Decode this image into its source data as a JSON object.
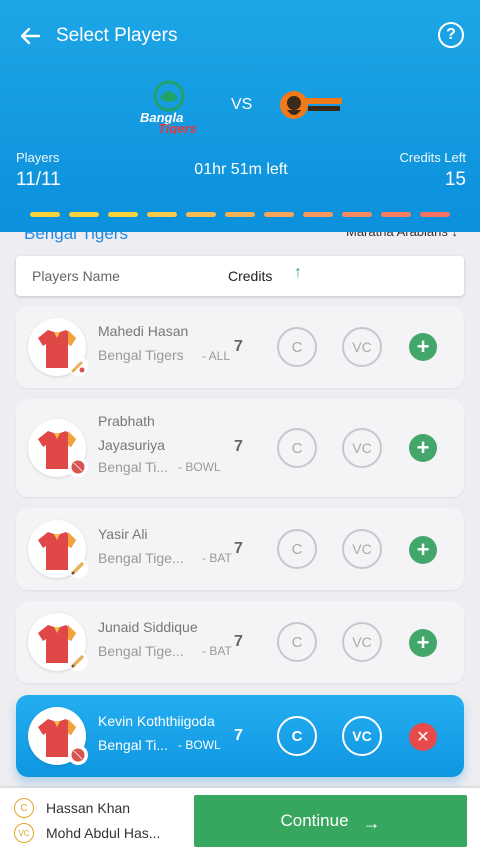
{
  "header": {
    "title": "Select Players",
    "home_team_logo_text": [
      "Bangla",
      "Tigers"
    ],
    "vs": "VS",
    "players_label": "Players",
    "players_value": "11/11",
    "time_left": "01hr 51m left",
    "credits_label": "Credits Left",
    "credits_value": "15",
    "progress_colors": [
      "#f4d33b",
      "#f4d33b",
      "#f4d33b",
      "#f5c94a",
      "#f5bd52",
      "#f6b058",
      "#f6a35c",
      "#f7965f",
      "#f78a61",
      "#f77e61",
      "#f77361"
    ]
  },
  "team_row": {
    "left": "Bengal Tigers",
    "right": "Maratha Arabians ↓"
  },
  "columns": {
    "name": "Players Name",
    "credits": "Credits",
    "sort_arrow": "↑"
  },
  "players": [
    {
      "name": "Mahedi Hasan",
      "team": "Bengal Tigers",
      "role": "- ALL",
      "credits": "7",
      "c": "C",
      "vc": "VC",
      "action": "+",
      "role_icon": "bat-ball-icon"
    },
    {
      "name_line1": "Prabhath",
      "name_line2": "Jayasuriya",
      "team": "Bengal Ti...",
      "role": "- BOWL",
      "credits": "7",
      "c": "C",
      "vc": "VC",
      "action": "+",
      "role_icon": "ball-icon"
    },
    {
      "name": "Yasir Ali",
      "team": "Bengal Tige...",
      "role": "- BAT",
      "credits": "7",
      "c": "C",
      "vc": "VC",
      "action": "+",
      "role_icon": "bat-icon"
    },
    {
      "name": "Junaid Siddique",
      "team": "Bengal Tige...",
      "role": "- BAT",
      "credits": "7",
      "c": "C",
      "vc": "VC",
      "action": "+",
      "role_icon": "bat-icon"
    },
    {
      "name": "Kevin Koththiigoda",
      "team": "Bengal Ti...",
      "role": "- BOWL",
      "credits": "7",
      "c": "C",
      "vc": "VC",
      "action": "✕",
      "role_icon": "ball-icon",
      "selected": true
    }
  ],
  "bottom": {
    "captain_badge": "C",
    "captain": "Hassan Khan",
    "vice_captain_badge": "VC",
    "vice_captain": "Mohd Abdul Has...",
    "continue": "Continue",
    "continue_arrow": "→"
  },
  "colors": {
    "header_blue": "#0b90dc",
    "continue_green": "#37a65f",
    "add_green": "#43a66b",
    "remove_red": "#e64a4a",
    "badge_gold": "#e3a429"
  }
}
